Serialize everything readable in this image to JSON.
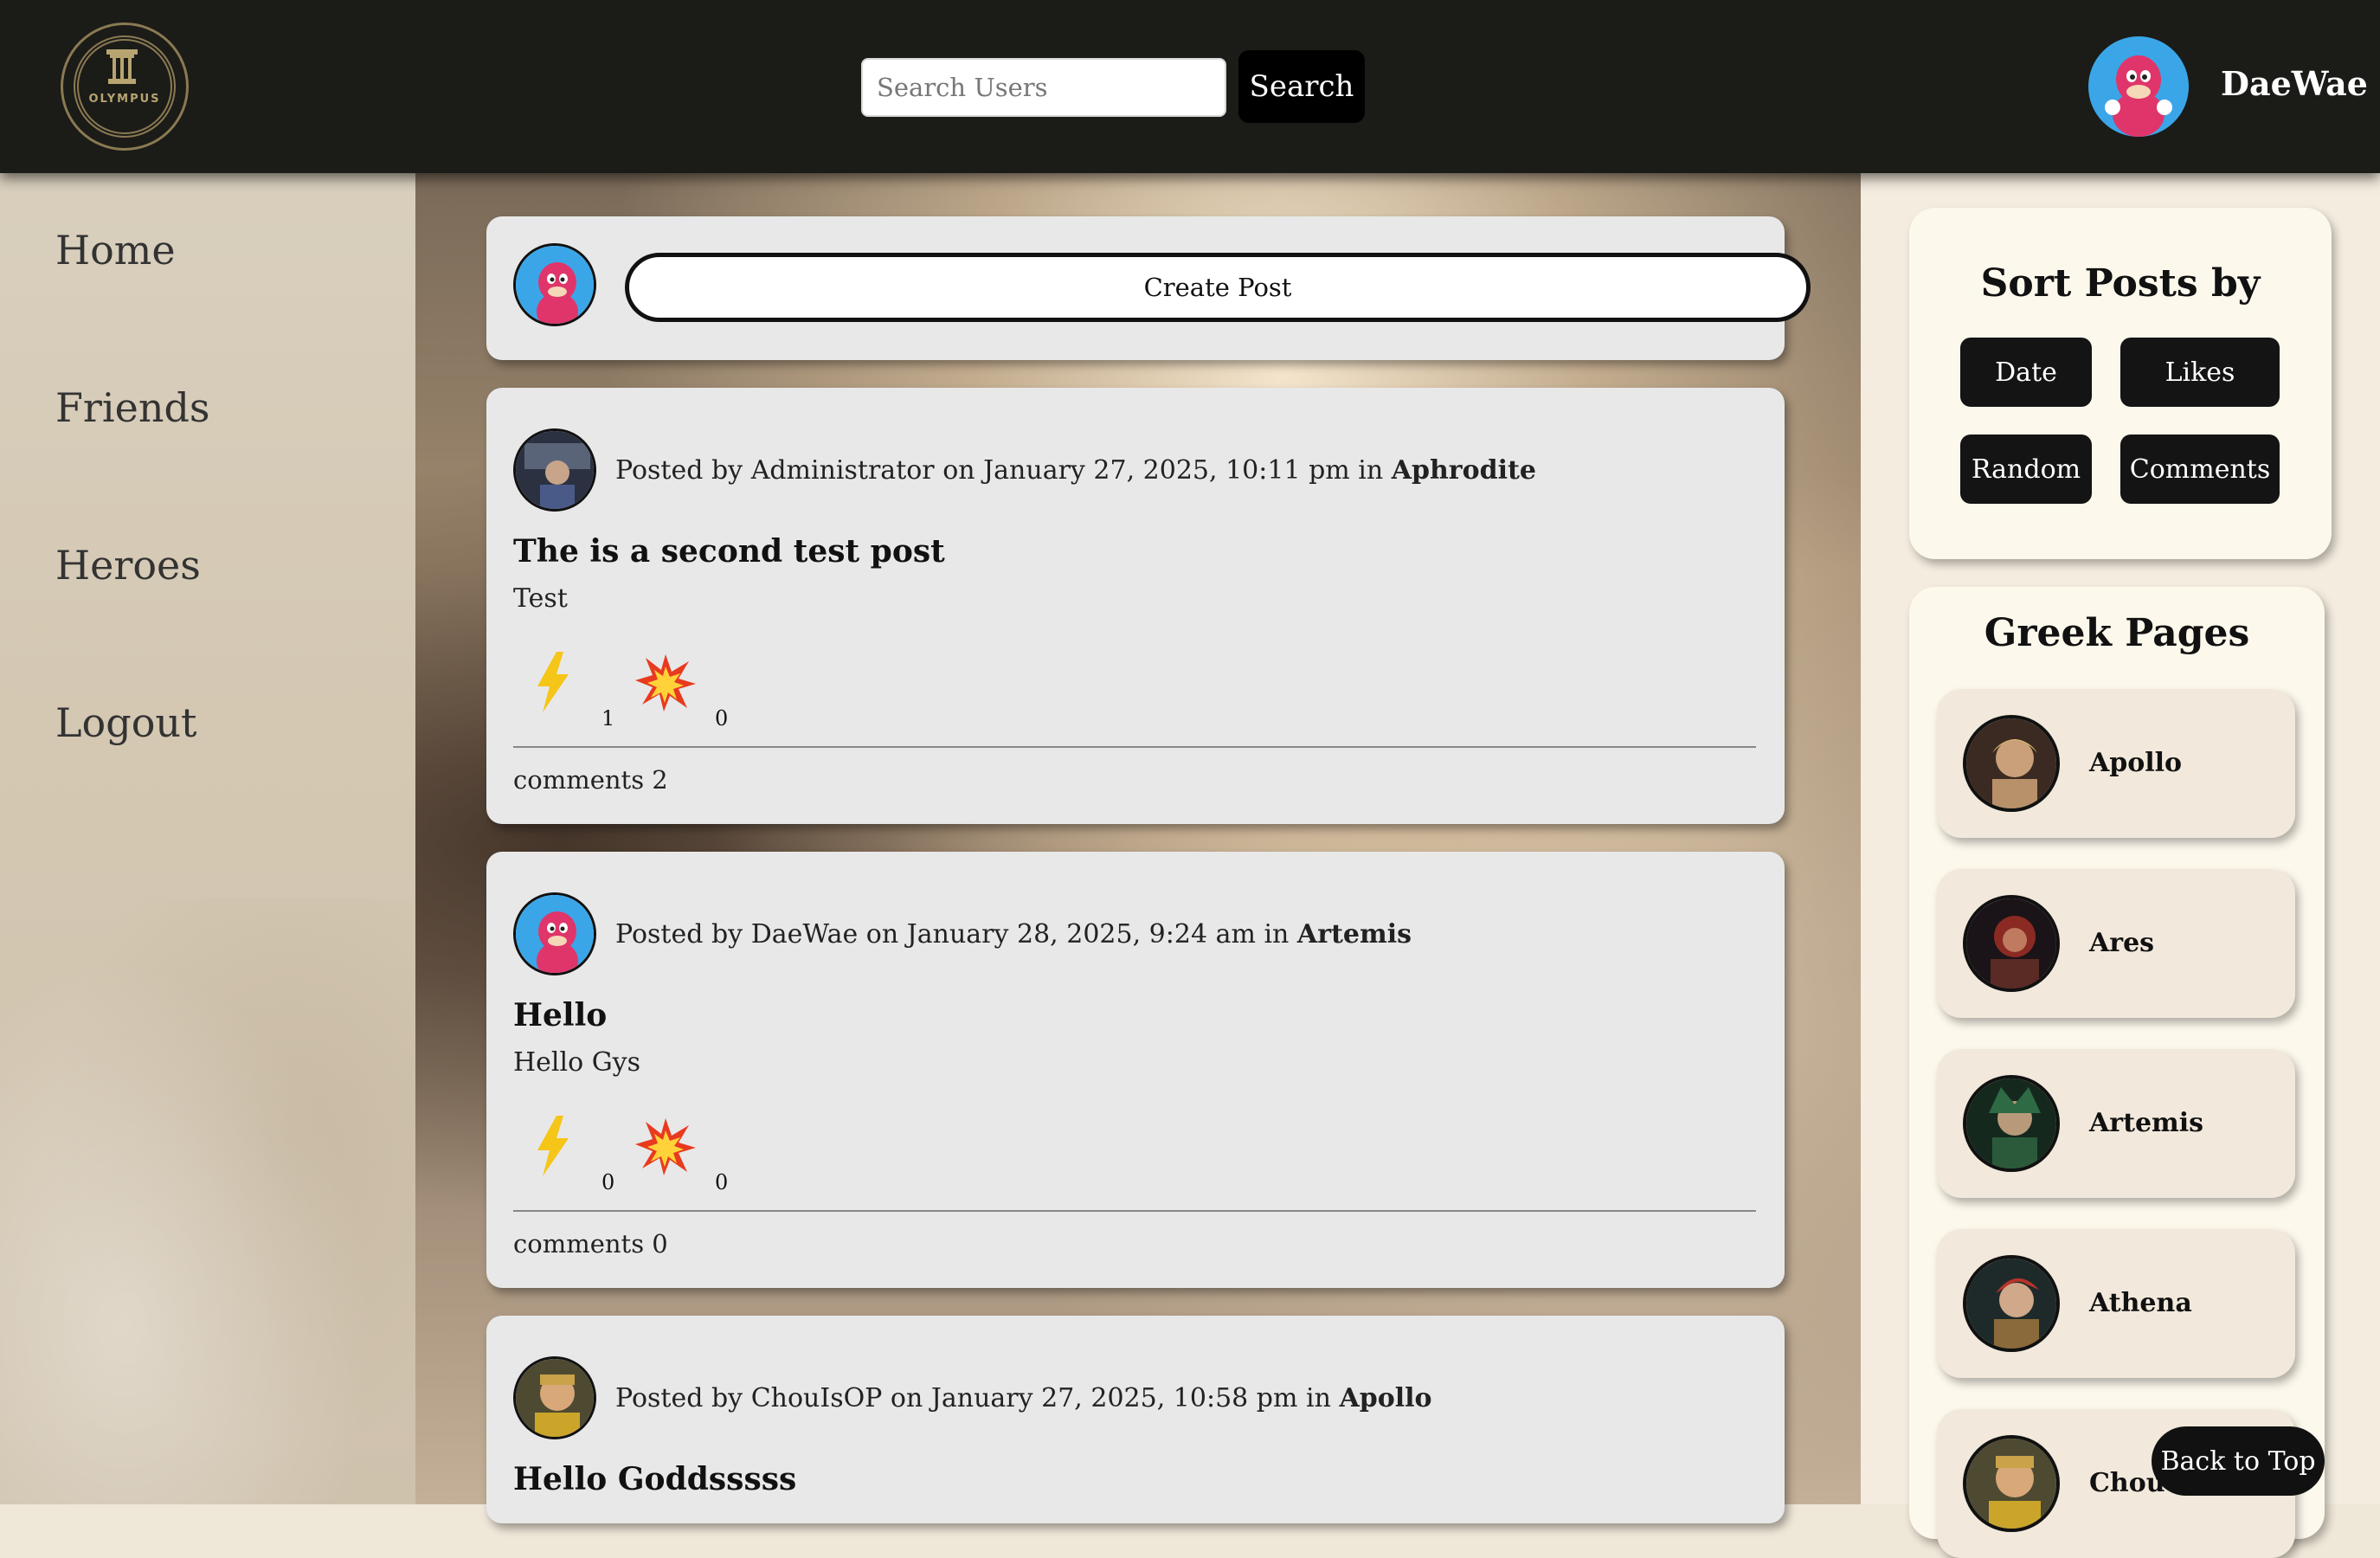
{
  "header": {
    "logo_text": "OLYMPUS",
    "search_placeholder": "Search Users",
    "search_button": "Search",
    "username": "DaeWae"
  },
  "nav": {
    "items": [
      {
        "label": "Home"
      },
      {
        "label": "Friends"
      },
      {
        "label": "Heroes"
      },
      {
        "label": "Logout"
      }
    ]
  },
  "create_post": {
    "label": "Create Post"
  },
  "posts": [
    {
      "author": "Administrator",
      "date": "January 27, 2025, 10:11 pm",
      "group": "Aphrodite",
      "title": "The is a second test post",
      "body": "Test",
      "zap_count": "1",
      "boom_count": "0",
      "comments": "comments 2"
    },
    {
      "author": "DaeWae",
      "date": "January 28, 2025, 9:24 am",
      "group": "Artemis",
      "title": "Hello",
      "body": "Hello Gys",
      "zap_count": "0",
      "boom_count": "0",
      "comments": "comments 0"
    },
    {
      "author": "ChouIsOP",
      "date": "January 27, 2025, 10:58 pm",
      "group": "Apollo",
      "title": "Hello Goddsssss"
    }
  ],
  "post_text": {
    "posted_by": "Posted by",
    "on": "on",
    "in": "in"
  },
  "sort": {
    "title": "Sort Posts by",
    "buttons": [
      "Date",
      "Likes",
      "Random",
      "Comments"
    ]
  },
  "greek_pages": {
    "title": "Greek Pages",
    "items": [
      "Apollo",
      "Ares",
      "Artemis",
      "Athena",
      "ChouG"
    ]
  },
  "back_to_top": "Back to Top",
  "colors": {
    "header_bg": "#1b1b18",
    "card_bg": "#e8e8e8",
    "panel_bg": "#fdf8ec",
    "button_bg": "#141414",
    "zap": "#f5c518",
    "boom": "#e83a1e"
  }
}
